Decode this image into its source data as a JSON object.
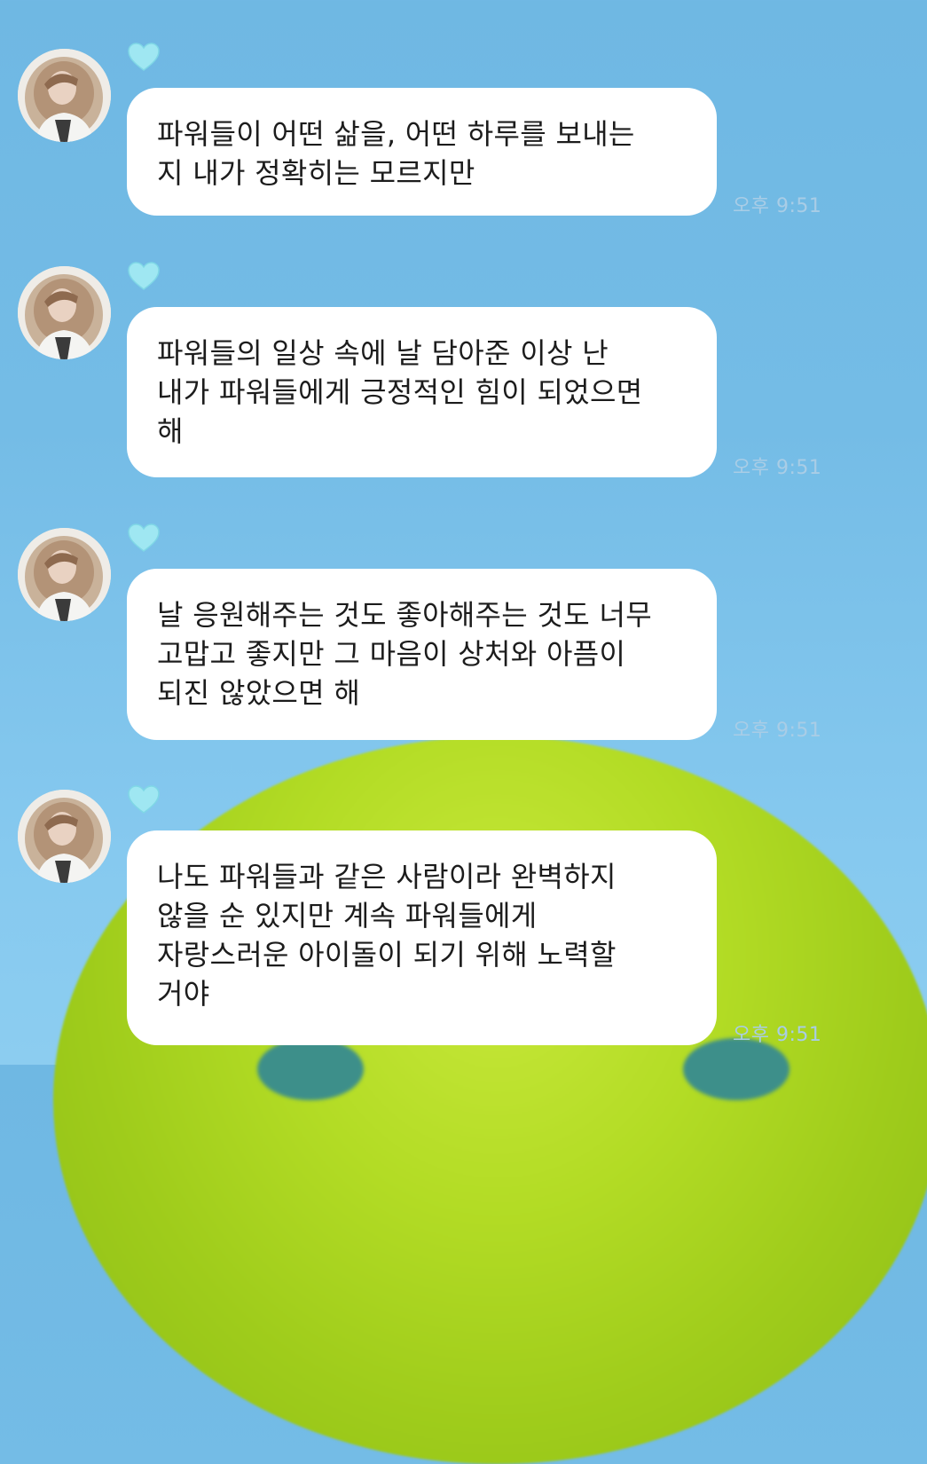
{
  "messages": [
    {
      "text": "파워들이 어떤 삶을, 어떤 하루를 보내는\n지 내가 정확히는 모르지만",
      "time": "오후 9:51"
    },
    {
      "text": "파워들의 일상 속에 날 담아준 이상 난\n내가 파워들에게 긍정적인 힘이 되었으면\n해",
      "time": "오후 9:51"
    },
    {
      "text": "날 응원해주는 것도 좋아해주는 것도 너무\n고맙고 좋지만 그 마음이 상처와 아픔이\n되진 않았으면 해",
      "time": "오후 9:51"
    },
    {
      "text": "나도 파워들과 같은 사람이라 완벽하지\n않을 순 있지만 계속 파워들에게\n자랑스러운 아이돌이 되기 위해 노력할\n거야",
      "time": "오후 9:51"
    }
  ],
  "colors": {
    "heart": "#9fe7f2",
    "bubble": "#ffffff",
    "timestamp": "#a9cde6"
  },
  "icons": {
    "badge": "light-blue-heart-icon"
  }
}
